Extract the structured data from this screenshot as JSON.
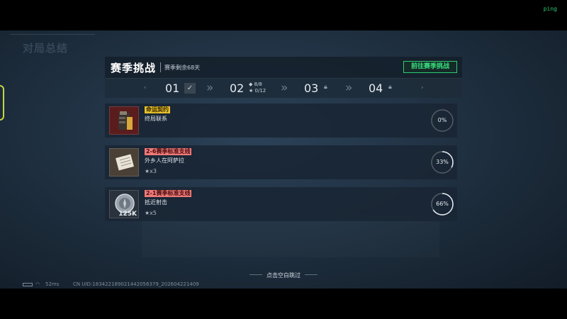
{
  "ping_label": "ping",
  "background_title": "对局总结",
  "panel": {
    "title": "赛季挑战",
    "season_remaining": "赛季剩余68天",
    "goto_button": "前往赛季挑战"
  },
  "stages": [
    {
      "number": "01",
      "state": "complete",
      "icon": "check-icon"
    },
    {
      "number": "02",
      "state": "current",
      "diamond_progress": "8/8",
      "star_progress": "0/12"
    },
    {
      "number": "03",
      "state": "locked",
      "icon": "lock-icon"
    },
    {
      "number": "04",
      "state": "locked",
      "icon": "lock-icon"
    }
  ],
  "tasks": [
    {
      "tag": "命运契约",
      "tag_color": "yellow",
      "name": "终局联系",
      "reward": "",
      "progress": 0,
      "progress_label": "0%",
      "thumb_label": "",
      "thumb": "armor"
    },
    {
      "tag": "2-6赛季标准支线",
      "tag_color": "red",
      "name": "外乡人在阿萨拉",
      "reward": "★x3",
      "progress": 0.33,
      "progress_label": "33%",
      "thumb_label": "",
      "thumb": "document"
    },
    {
      "tag": "2-1赛季标准支线",
      "tag_color": "red",
      "name": "抵近射击",
      "reward": "★x5",
      "progress": 0.66,
      "progress_label": "66%",
      "thumb_label": "125K",
      "thumb": "coin"
    }
  ],
  "skip_hint": "点击空白跳过",
  "footer": {
    "latency": "52ms",
    "uid": "CN UID:1834221890214420563​79_202604221409"
  },
  "colors": {
    "accent_green": "#39e07f",
    "tag_yellow": "#e8c22c",
    "tag_red": "#f07a7a"
  }
}
